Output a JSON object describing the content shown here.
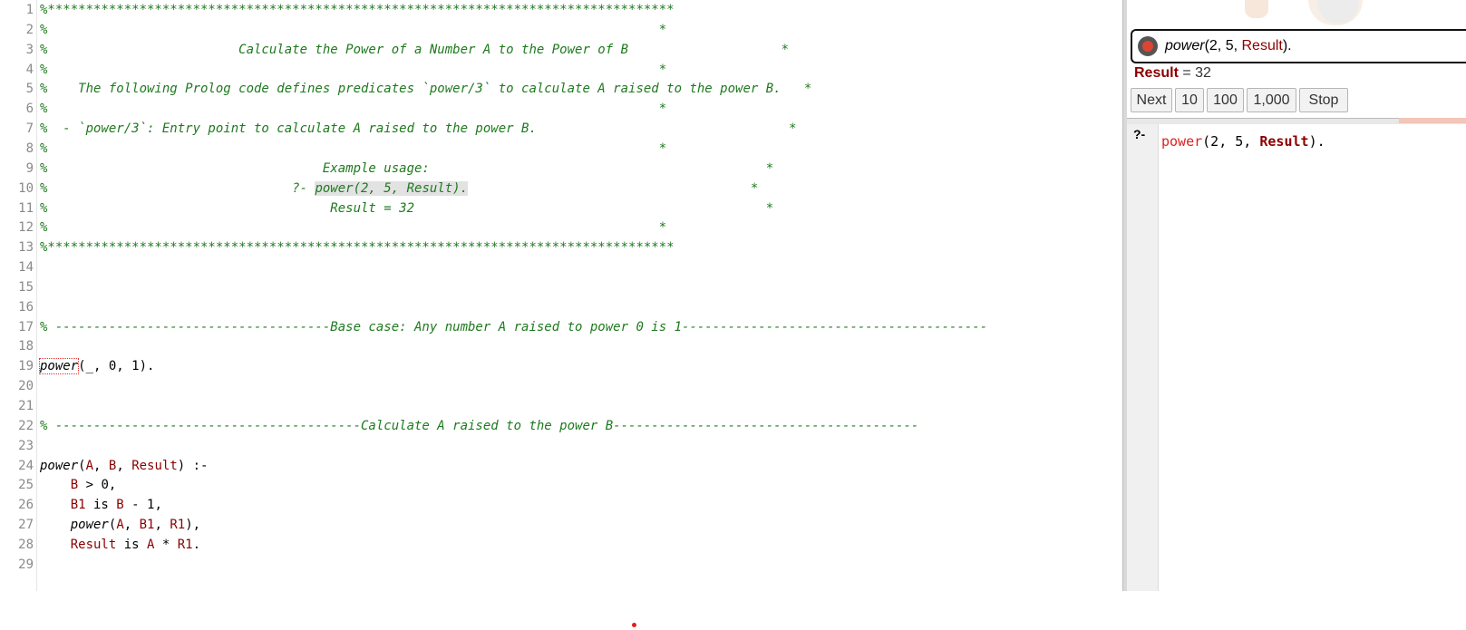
{
  "editor": {
    "lines": [
      {
        "n": "1",
        "parts": [
          {
            "t": "%**********************************************************************************",
            "c": "cm"
          }
        ]
      },
      {
        "n": "2",
        "parts": [
          {
            "t": "%                                                                                *",
            "c": "cm"
          }
        ]
      },
      {
        "n": "3",
        "parts": [
          {
            "t": "%                         Calculate the Power of a Number A to the Power of B                    *",
            "c": "cm"
          }
        ]
      },
      {
        "n": "4",
        "parts": [
          {
            "t": "%                                                                                *",
            "c": "cm"
          }
        ]
      },
      {
        "n": "5",
        "parts": [
          {
            "t": "%    The following Prolog code defines predicates `power/3` to calculate A raised to the power B.   *",
            "c": "cm"
          }
        ]
      },
      {
        "n": "6",
        "parts": [
          {
            "t": "%                                                                                *",
            "c": "cm"
          }
        ]
      },
      {
        "n": "7",
        "parts": [
          {
            "t": "%  - `power/3`: Entry point to calculate A raised to the power B.                                 *",
            "c": "cm"
          }
        ]
      },
      {
        "n": "8",
        "parts": [
          {
            "t": "%                                                                                *",
            "c": "cm"
          }
        ]
      },
      {
        "n": "9",
        "parts": [
          {
            "t": "%                                    Example usage:                                            *",
            "c": "cm"
          }
        ]
      },
      {
        "n": "10",
        "parts": [
          {
            "t": "%                                ?- ",
            "c": "cm"
          },
          {
            "t": "power(2, 5, Result).",
            "c": "cm hl"
          },
          {
            "t": "                                     *",
            "c": "cm"
          }
        ]
      },
      {
        "n": "11",
        "parts": [
          {
            "t": "%                                     Result = 32                                              *",
            "c": "cm"
          }
        ]
      },
      {
        "n": "12",
        "parts": [
          {
            "t": "%                                                                                *",
            "c": "cm"
          }
        ]
      },
      {
        "n": "13",
        "parts": [
          {
            "t": "%**********************************************************************************",
            "c": "cm"
          }
        ]
      },
      {
        "n": "14",
        "parts": []
      },
      {
        "n": "15",
        "parts": []
      },
      {
        "n": "16",
        "parts": []
      },
      {
        "n": "17",
        "parts": [
          {
            "t": "% ------------------------------------Base case: Any number A raised to power 0 is 1----------------------------------------",
            "c": "cm"
          }
        ]
      },
      {
        "n": "18",
        "parts": []
      },
      {
        "n": "19",
        "parts": [
          {
            "t": "power",
            "c": "pred-boxed"
          },
          {
            "t": "(_, 0, 1).",
            "c": "num"
          }
        ]
      },
      {
        "n": "20",
        "parts": []
      },
      {
        "n": "21",
        "parts": []
      },
      {
        "n": "22",
        "parts": [
          {
            "t": "% ----------------------------------------Calculate A raised to the power B----------------------------------------",
            "c": "cm"
          }
        ]
      },
      {
        "n": "23",
        "parts": []
      },
      {
        "n": "24",
        "parts": [
          {
            "t": "power",
            "c": "pred"
          },
          {
            "t": "(",
            "c": "num"
          },
          {
            "t": "A",
            "c": "var"
          },
          {
            "t": ", ",
            "c": "num"
          },
          {
            "t": "B",
            "c": "var"
          },
          {
            "t": ", ",
            "c": "num"
          },
          {
            "t": "Result",
            "c": "var"
          },
          {
            "t": ") :-",
            "c": "num"
          }
        ]
      },
      {
        "n": "25",
        "parts": [
          {
            "t": "    ",
            "c": "num"
          },
          {
            "t": "B",
            "c": "var"
          },
          {
            "t": " > 0,",
            "c": "num"
          }
        ]
      },
      {
        "n": "26",
        "parts": [
          {
            "t": "    ",
            "c": "num"
          },
          {
            "t": "B1",
            "c": "var"
          },
          {
            "t": " is ",
            "c": "num"
          },
          {
            "t": "B",
            "c": "var"
          },
          {
            "t": " - 1,",
            "c": "num"
          }
        ]
      },
      {
        "n": "27",
        "parts": [
          {
            "t": "    ",
            "c": "num"
          },
          {
            "t": "power",
            "c": "pred"
          },
          {
            "t": "(",
            "c": "num"
          },
          {
            "t": "A",
            "c": "var"
          },
          {
            "t": ", ",
            "c": "num"
          },
          {
            "t": "B1",
            "c": "var"
          },
          {
            "t": ", ",
            "c": "num"
          },
          {
            "t": "R1",
            "c": "var"
          },
          {
            "t": "),",
            "c": "num"
          }
        ]
      },
      {
        "n": "28",
        "parts": [
          {
            "t": "    ",
            "c": "num"
          },
          {
            "t": "Result",
            "c": "var"
          },
          {
            "t": " is ",
            "c": "num"
          },
          {
            "t": "A",
            "c": "var"
          },
          {
            "t": " * ",
            "c": "num"
          },
          {
            "t": "R1",
            "c": "var"
          },
          {
            "t": ".",
            "c": "num"
          }
        ]
      },
      {
        "n": "29",
        "parts": []
      }
    ]
  },
  "answer": {
    "query_pred": "power",
    "query_open": "(2, 5, ",
    "query_var": "Result",
    "query_close": ").",
    "result_var": "Result",
    "result_eq": " = 32",
    "buttons": [
      "Next",
      "10",
      "100",
      "1,000",
      "Stop"
    ]
  },
  "prompt": {
    "symbol": "?-",
    "pred": "power",
    "args": "(2, 5, ",
    "var": "Result",
    "close": ")."
  },
  "colors": {
    "comment": "#1e7a1e",
    "variable": "#8b0000",
    "predicate_red": "#e02020",
    "highlight": "#e2e2e2"
  }
}
